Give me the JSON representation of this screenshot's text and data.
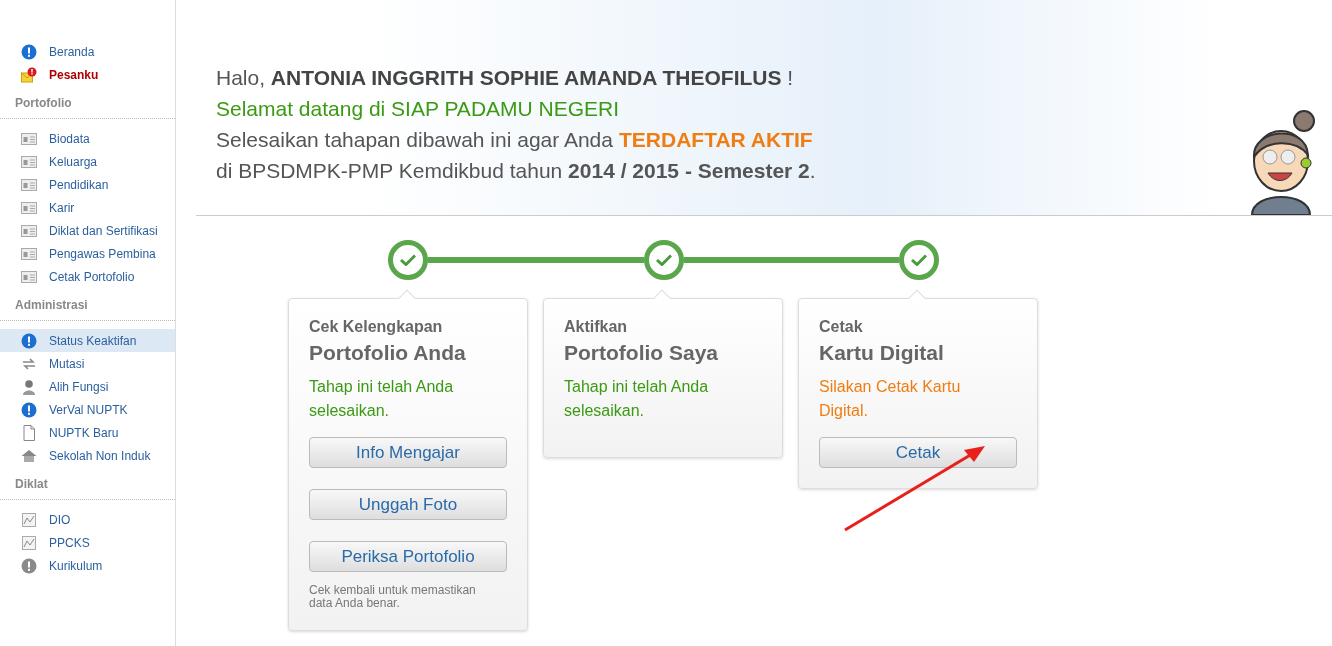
{
  "sidebar": {
    "top_items": [
      {
        "label": "Beranda",
        "kind": "info",
        "alert": false
      },
      {
        "label": "Pesanku",
        "kind": "mail",
        "alert": true
      }
    ],
    "sections": [
      {
        "title": "Portofolio",
        "items": [
          {
            "label": "Biodata",
            "kind": "card",
            "selected": false
          },
          {
            "label": "Keluarga",
            "kind": "card",
            "selected": false
          },
          {
            "label": "Pendidikan",
            "kind": "card",
            "selected": false
          },
          {
            "label": "Karir",
            "kind": "card",
            "selected": false
          },
          {
            "label": "Diklat dan Sertifikasi",
            "kind": "card",
            "selected": false
          },
          {
            "label": "Pengawas Pembina",
            "kind": "card",
            "selected": false
          },
          {
            "label": "Cetak Portofolio",
            "kind": "card",
            "selected": false
          }
        ]
      },
      {
        "title": "Administrasi",
        "items": [
          {
            "label": "Status Keaktifan",
            "kind": "info",
            "selected": true
          },
          {
            "label": "Mutasi",
            "kind": "swap",
            "selected": false
          },
          {
            "label": "Alih Fungsi",
            "kind": "person",
            "selected": false
          },
          {
            "label": "VerVal NUPTK",
            "kind": "info",
            "selected": false
          },
          {
            "label": "NUPTK Baru",
            "kind": "page",
            "selected": false
          },
          {
            "label": "Sekolah Non Induk",
            "kind": "house",
            "selected": false
          }
        ]
      },
      {
        "title": "Diklat",
        "items": [
          {
            "label": "DIO",
            "kind": "chart",
            "selected": false
          },
          {
            "label": "PPCKS",
            "kind": "chart",
            "selected": false
          },
          {
            "label": "Kurikulum",
            "kind": "info-muted",
            "selected": false
          }
        ]
      }
    ]
  },
  "welcome": {
    "greeting": "Halo, **ANTONIA INGGRITH SOPHIE AMANDA THEOFILUS** !",
    "subtitle": "Selamat datang di SIAP PADAMU NEGERI",
    "instruction_start": "Selesaikan tahapan dibawah ini agar Anda",
    "instruction_highlight": "TERDAFTAR AKTIF",
    "instruction_end": "di BPSDMPK-PMP Kemdikbud tahun **2014 / 2015 - Semester 2**."
  },
  "steps": [
    {
      "kicker": "Cek Kelengkapan",
      "title": "Portofolio Anda",
      "message": "Tahap ini telah Anda selesaikan.",
      "kind": "done",
      "completed": true,
      "buttons": [
        "Info Mengajar",
        "Unggah Foto",
        "Periksa Portofolio"
      ],
      "note": "Cek kembali untuk memastikan data Anda benar."
    },
    {
      "kicker": "Aktifkan",
      "title": "Portofolio Saya",
      "message": "Tahap ini telah Anda selesaikan.",
      "kind": "done",
      "completed": true
    },
    {
      "kicker": "Cetak",
      "title": "Kartu Digital",
      "message": "Silakan Cetak Kartu Digital.",
      "kind": "todo",
      "completed": true,
      "buttons": [
        "Cetak"
      ]
    }
  ]
}
